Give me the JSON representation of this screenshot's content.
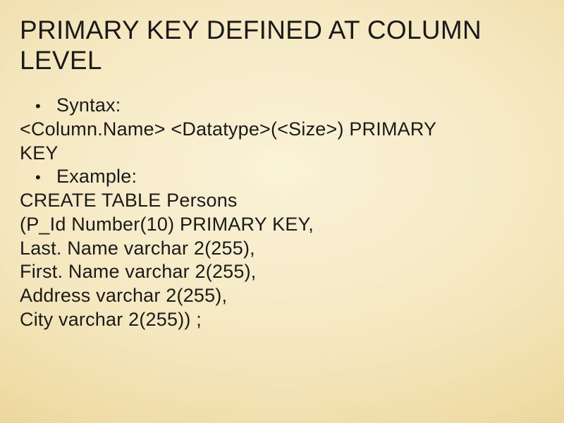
{
  "title": "PRIMARY KEY DEFINED AT COLUMN LEVEL",
  "bullets": {
    "b1": "Syntax:",
    "b2": "Example:"
  },
  "lines": {
    "syntax1": "<Column.Name> <Datatype>(<Size>) PRIMARY",
    "syntax2": "KEY",
    "ex1": "CREATE TABLE Persons",
    "ex2": "(P_Id Number(10) PRIMARY KEY,",
    "ex3": "Last. Name varchar 2(255),",
    "ex4": "First. Name varchar 2(255),",
    "ex5": "Address varchar 2(255),",
    "ex6": "City varchar 2(255)) ;"
  }
}
